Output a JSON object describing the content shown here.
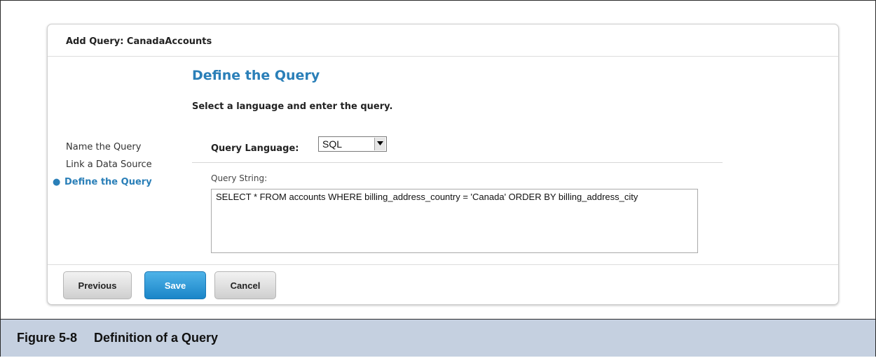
{
  "dialog": {
    "title": "Add Query: CanadaAccounts"
  },
  "section": {
    "heading": "Define the Query",
    "subtitle": "Select a language and enter the query."
  },
  "steps": [
    {
      "label": "Name the Query",
      "active": false
    },
    {
      "label": "Link a Data Source",
      "active": false
    },
    {
      "label": "Define the Query",
      "active": true
    }
  ],
  "form": {
    "language_label": "Query Language:",
    "language_value": "SQL",
    "query_string_label": "Query String:",
    "query_string_value": "SELECT * FROM accounts WHERE billing_address_country = 'Canada' ORDER BY billing_address_city"
  },
  "footer": {
    "previous_label": "Previous",
    "save_label": "Save",
    "cancel_label": "Cancel"
  },
  "figure": {
    "number": "Figure 5-8",
    "title": "Definition of a Query"
  },
  "colors": {
    "accent": "#2a7fb8",
    "save_button": "#1a85c8",
    "caption_bar": "#c5d0e0"
  },
  "icons": {
    "select_arrow": "chevron-down-icon",
    "step_bullet": "bullet-icon"
  }
}
